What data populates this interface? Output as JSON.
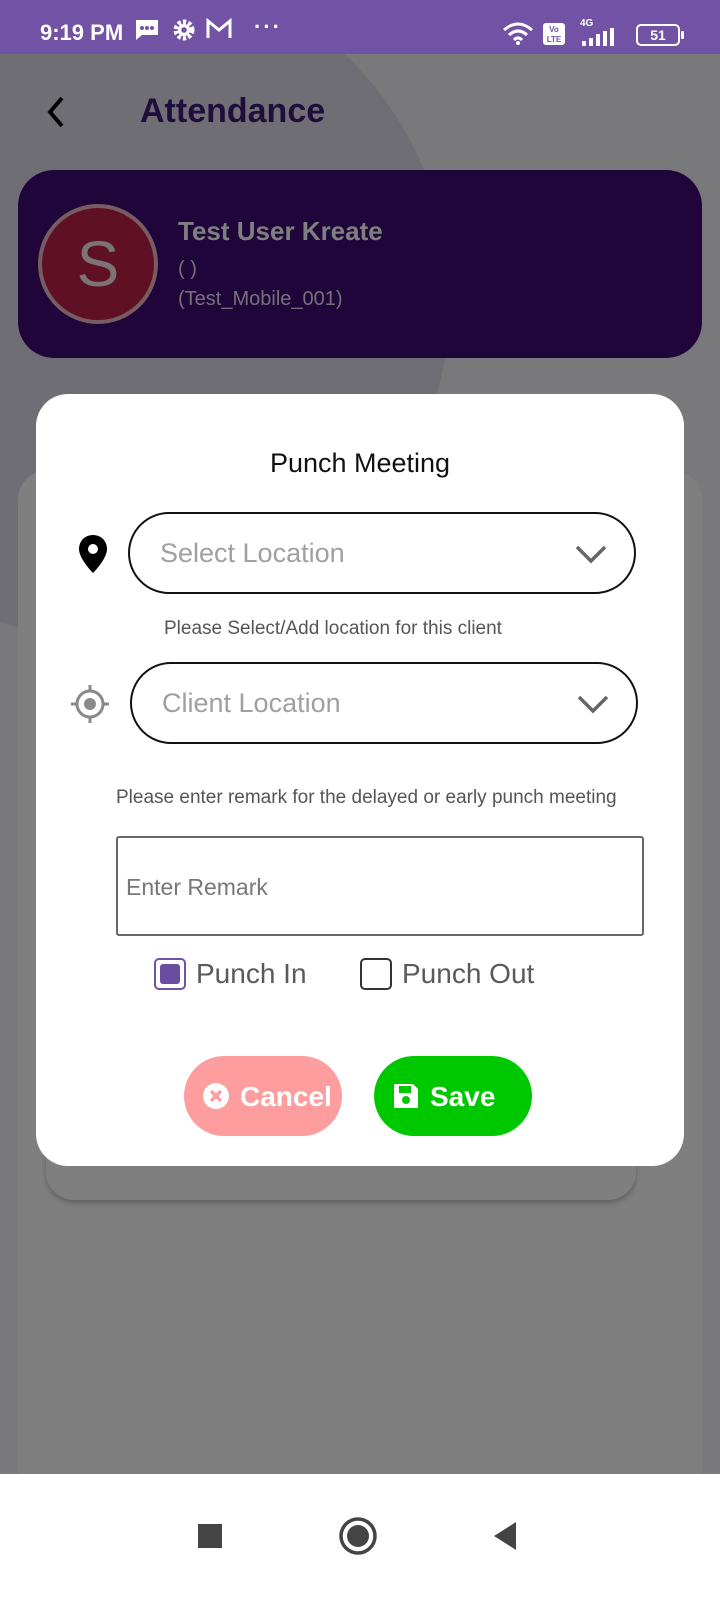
{
  "status_bar": {
    "time": "9:19 PM",
    "icons": [
      "message-icon",
      "gear-icon",
      "gmail-icon",
      "more-dots-icon",
      "wifi-icon",
      "volte-icon",
      "signal-4g-icon"
    ],
    "dots": "···",
    "network": "4G",
    "battery": "51"
  },
  "header": {
    "title": "Attendance",
    "back_icon": "chevron-left-icon"
  },
  "profile": {
    "initial": "S",
    "name": "Test User Kreate",
    "role": "( )",
    "id": "(Test_Mobile_001)",
    "avatar_color": "#c1204a",
    "card_color": "#3e0b73"
  },
  "dialog": {
    "title": "Punch Meeting",
    "location_select": {
      "placeholder": "Select Location",
      "icon": "map-pin-icon"
    },
    "location_hint": "Please Select/Add location for this client",
    "client_location_select": {
      "placeholder": "Client Location",
      "icon": "crosshair-icon"
    },
    "remark_hint": "Please enter remark for the delayed or early punch meeting",
    "remark_input": {
      "placeholder": "Enter Remark",
      "value": ""
    },
    "options": [
      {
        "label": "Punch In",
        "checked": true
      },
      {
        "label": "Punch Out",
        "checked": false
      }
    ],
    "cancel_label": "Cancel",
    "save_label": "Save",
    "colors": {
      "cancel": "#fe9d9d",
      "save": "#00c800",
      "accent": "#7152a4"
    }
  },
  "nav_bar": {
    "buttons": [
      "recents-button",
      "home-button",
      "back-button"
    ]
  }
}
